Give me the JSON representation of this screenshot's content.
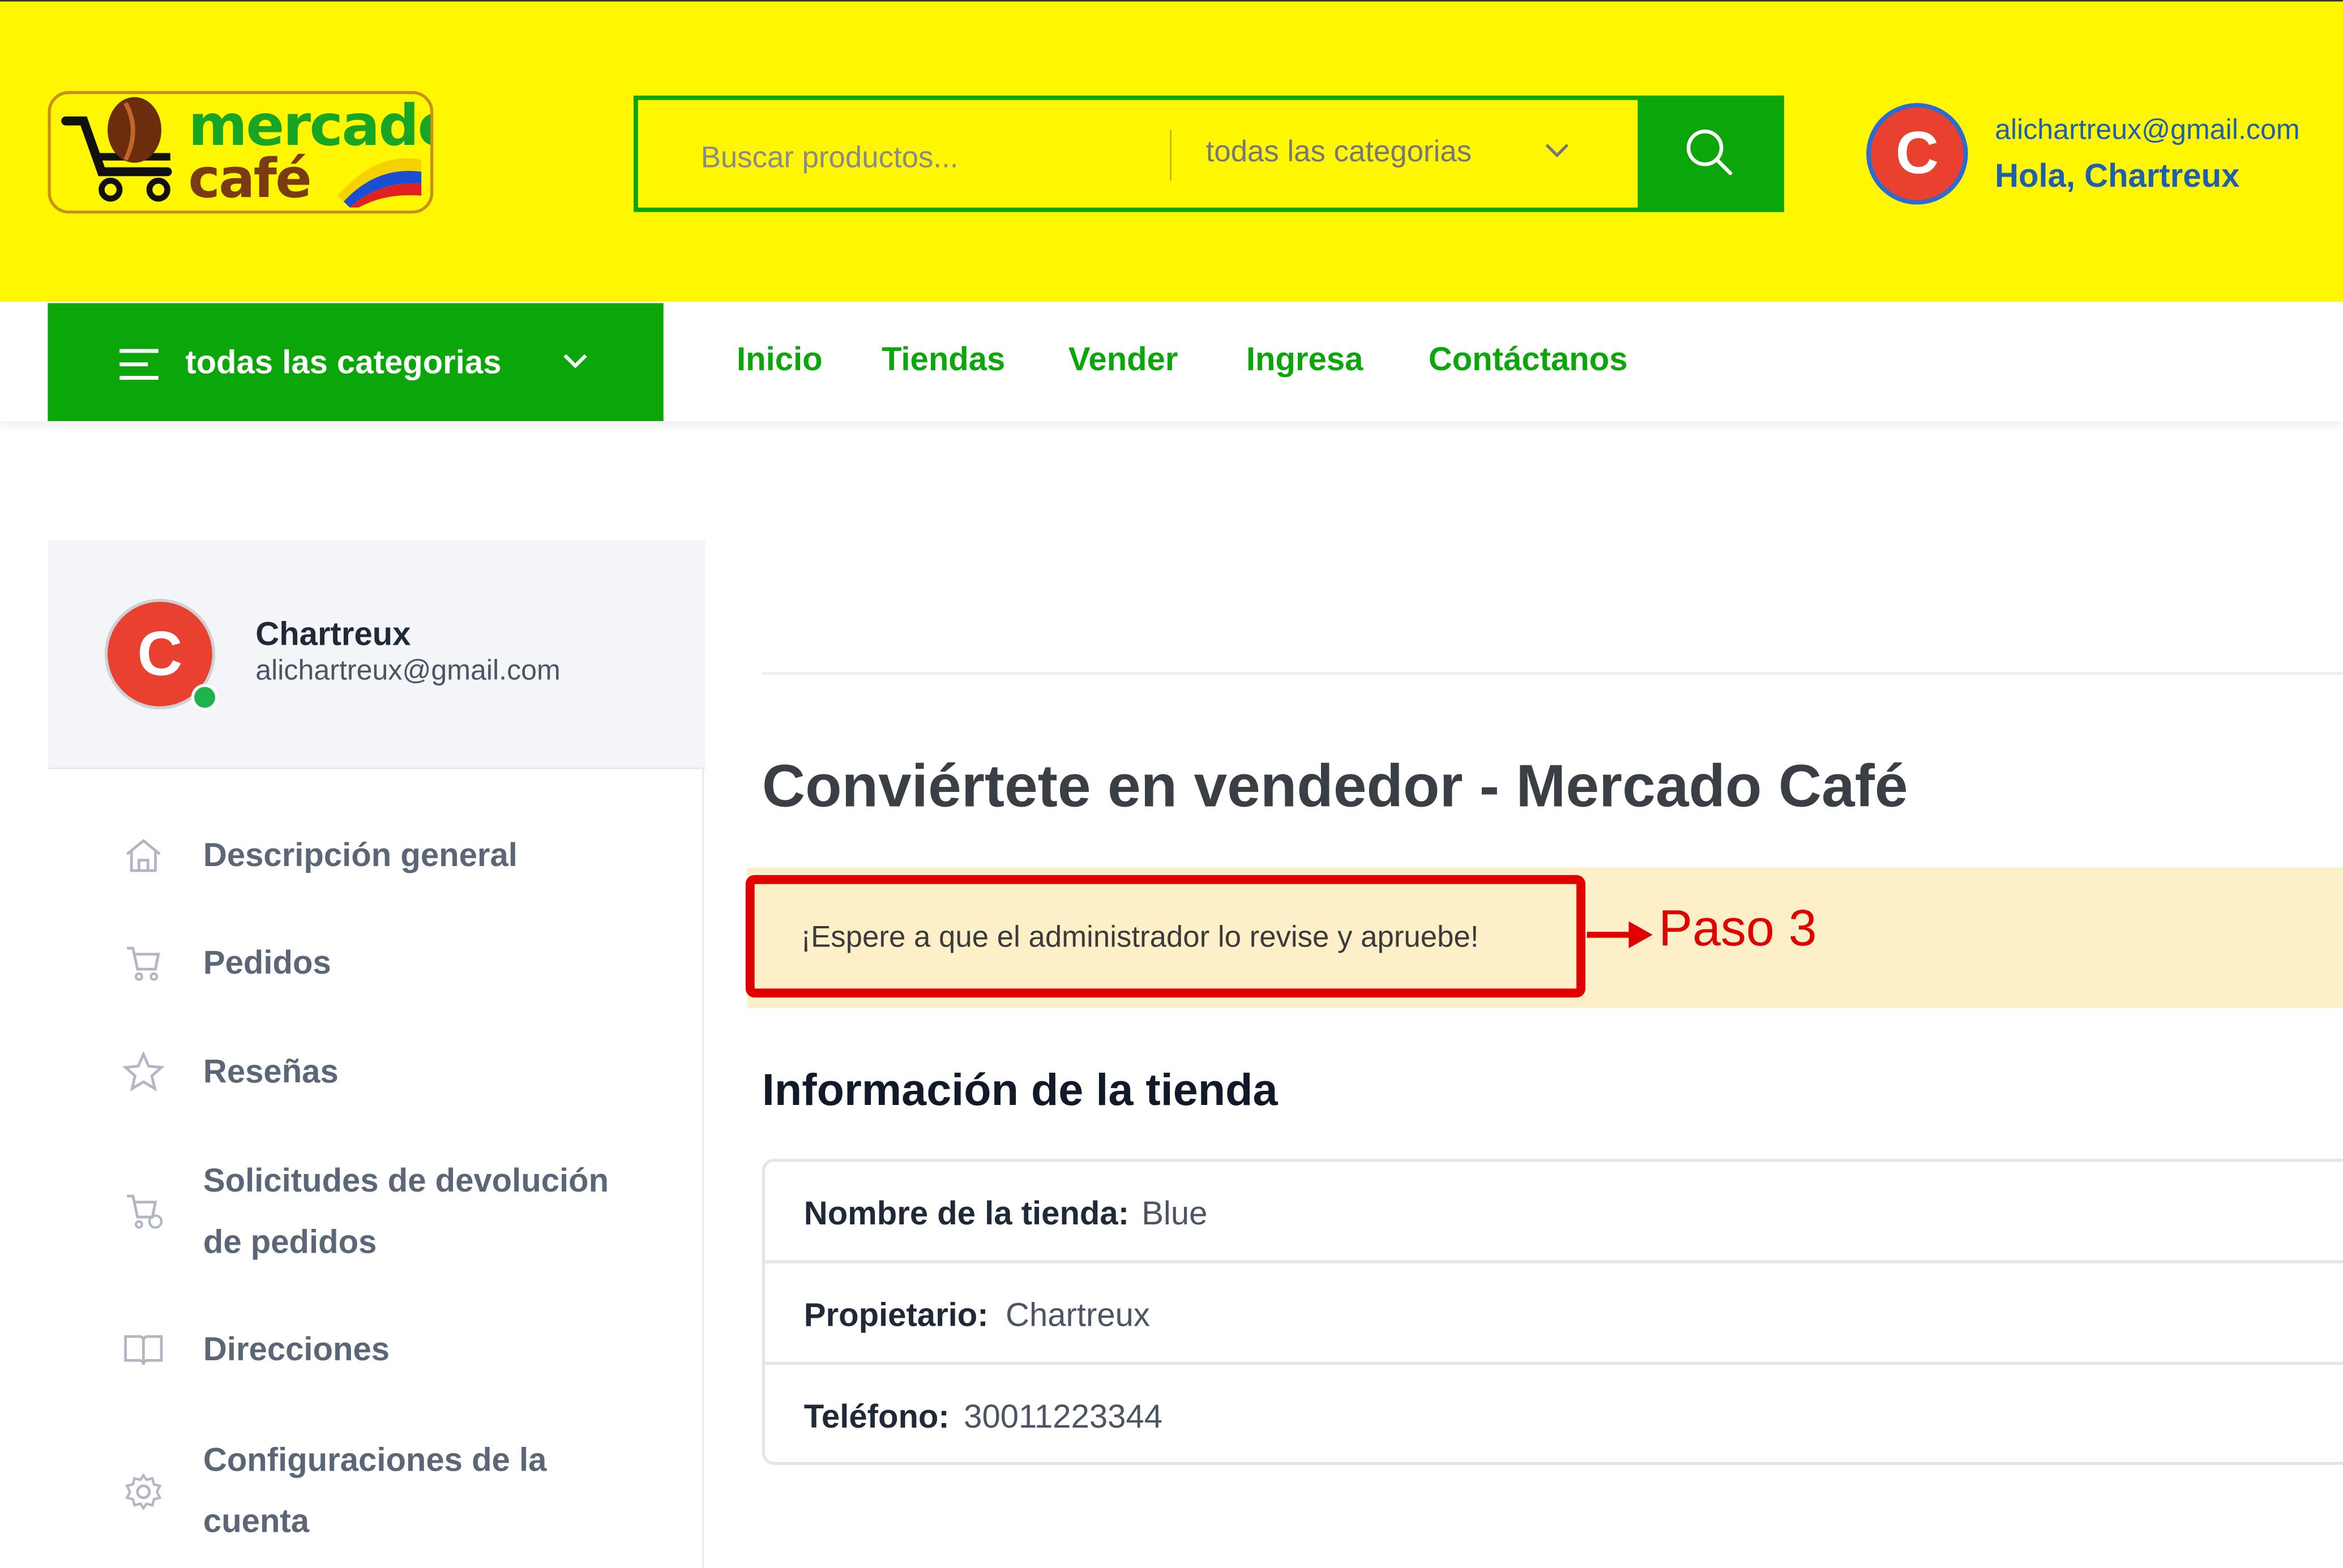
{
  "header": {
    "logo_line1": "mercado",
    "logo_line2": "café",
    "search_placeholder": "Buscar productos...",
    "search_category": "todas las categorias",
    "avatar_letter": "C",
    "user_email": "alichartreux@gmail.com",
    "greeting": "Hola, Chartreux"
  },
  "navbar": {
    "categories_button": "todas las categorias",
    "links": [
      "Inicio",
      "Tiendas",
      "Vender",
      "Ingresa",
      "Contáctanos"
    ]
  },
  "sidebar": {
    "profile": {
      "avatar_letter": "C",
      "name": "Chartreux",
      "email": "alichartreux@gmail.com"
    },
    "items": [
      {
        "label": "Descripción general",
        "icon": "home-icon"
      },
      {
        "label": "Pedidos",
        "icon": "cart-icon"
      },
      {
        "label": "Reseñas",
        "icon": "star-icon"
      },
      {
        "label_line1": "Solicitudes de devolución",
        "label_line2": "de pedidos",
        "icon": "cart-return-icon"
      },
      {
        "label": "Direcciones",
        "icon": "book-icon"
      },
      {
        "label_line1": "Configuraciones de la",
        "label_line2": "cuenta",
        "icon": "gear-icon"
      }
    ]
  },
  "main": {
    "title": "Conviértete en vendedor - Mercado Café",
    "alert_text": "¡Espere a que el administrador lo revise y apruebe!",
    "annotation": "Paso 3",
    "section_title": "Información de la tienda",
    "info": [
      {
        "key": "Nombre de la tienda",
        "value": "Blue"
      },
      {
        "key": "Propietario",
        "value": "Chartreux"
      },
      {
        "key": "Teléfono",
        "value": "30011223344"
      }
    ]
  },
  "colors": {
    "header_bg": "#fff701",
    "brand_green": "#0aa60a",
    "avatar_red": "#e8412f",
    "alert_bg": "#fdf0c8",
    "annotation_red": "#e10000"
  }
}
